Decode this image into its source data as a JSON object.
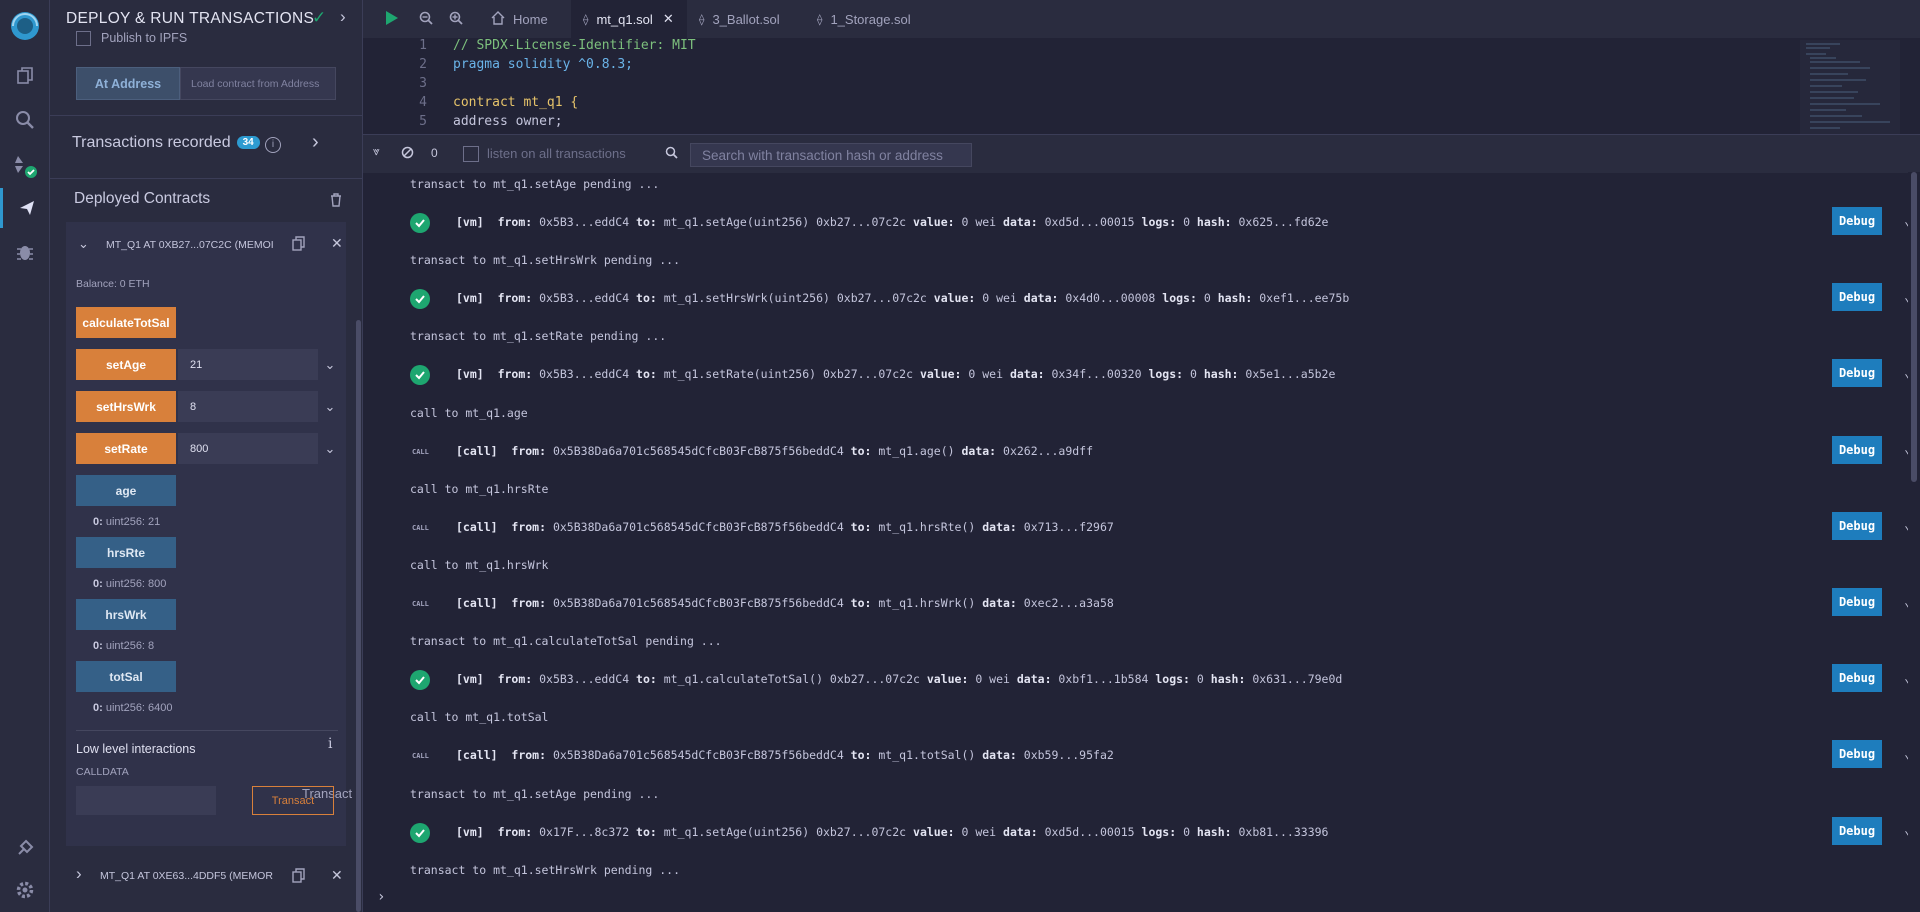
{
  "panel": {
    "title": "DEPLOY & RUN TRANSACTIONS",
    "publish_ipfs": "Publish to IPFS",
    "at_address_button": "At Address",
    "load_contract_placeholder": "Load contract from Address",
    "transactions_recorded": "Transactions recorded",
    "transactions_count": "34",
    "deployed_contracts": "Deployed Contracts",
    "instance_title": "MT_Q1 AT 0XB27...07C2C (MEMOI",
    "balance": "Balance: 0 ETH",
    "functions": {
      "calculate": "calculateTotSal",
      "setAge": {
        "label": "setAge",
        "value": "21"
      },
      "setHrsWrk": {
        "label": "setHrsWrk",
        "value": "8"
      },
      "setRate": {
        "label": "setRate",
        "value": "800"
      },
      "age": {
        "label": "age",
        "ret_key": "0:",
        "ret_val": "uint256: 21"
      },
      "hrsRte": {
        "label": "hrsRte",
        "ret_key": "0:",
        "ret_val": "uint256: 800"
      },
      "hrsWrk": {
        "label": "hrsWrk",
        "ret_key": "0:",
        "ret_val": "uint256: 8"
      },
      "totSal": {
        "label": "totSal",
        "ret_key": "0:",
        "ret_val": "uint256: 6400"
      }
    },
    "low_level": "Low level interactions",
    "calldata": "CALLDATA",
    "transact": "Transact",
    "instance2_title": "MT_Q1 AT 0XE63...4DDF5 (MEMOR"
  },
  "tabs": [
    "Home",
    "mt_q1.sol",
    "3_Ballot.sol",
    "1_Storage.sol"
  ],
  "editor": {
    "line_numbers": [
      "1",
      "2",
      "3",
      "4",
      "5"
    ],
    "lines": [
      "// SPDX-License-Identifier: MIT",
      "pragma solidity ^0.8.3;",
      "",
      "contract mt_q1 {",
      "address owner;"
    ]
  },
  "terminal": {
    "pending_count": "0",
    "listen_label": "listen on all transactions",
    "search_placeholder": "Search with transaction hash or address",
    "debug_label": "Debug",
    "entries": [
      {
        "pre": "transact to mt_q1.setAge pending ...",
        "kind": "vm",
        "line": "[vm]  from: 0x5B3...eddC4 to: mt_q1.setAge(uint256) 0xb27...07c2c value: 0 wei data: 0xd5d...00015 logs: 0 hash: 0x625...fd62e"
      },
      {
        "pre": "transact to mt_q1.setHrsWrk pending ...",
        "kind": "vm",
        "line": "[vm]  from: 0x5B3...eddC4 to: mt_q1.setHrsWrk(uint256) 0xb27...07c2c value: 0 wei data: 0x4d0...00008 logs: 0 hash: 0xef1...ee75b"
      },
      {
        "pre": "transact to mt_q1.setRate pending ...",
        "kind": "vm",
        "line": "[vm]  from: 0x5B3...eddC4 to: mt_q1.setRate(uint256) 0xb27...07c2c value: 0 wei data: 0x34f...00320 logs: 0 hash: 0x5e1...a5b2e"
      },
      {
        "pre": "call to mt_q1.age",
        "kind": "call",
        "line": "[call]  from: 0x5B38Da6a701c568545dCfcB03FcB875f56beddC4 to: mt_q1.age() data: 0x262...a9dff"
      },
      {
        "pre": "call to mt_q1.hrsRte",
        "kind": "call",
        "line": "[call]  from: 0x5B38Da6a701c568545dCfcB03FcB875f56beddC4 to: mt_q1.hrsRte() data: 0x713...f2967"
      },
      {
        "pre": "call to mt_q1.hrsWrk",
        "kind": "call",
        "line": "[call]  from: 0x5B38Da6a701c568545dCfcB03FcB875f56beddC4 to: mt_q1.hrsWrk() data: 0xec2...a3a58"
      },
      {
        "pre": "transact to mt_q1.calculateTotSal pending ...",
        "kind": "vm",
        "line": "[vm]  from: 0x5B3...eddC4 to: mt_q1.calculateTotSal() 0xb27...07c2c value: 0 wei data: 0xbf1...1b584 logs: 0 hash: 0x631...79e0d"
      },
      {
        "pre": "call to mt_q1.totSal",
        "kind": "call",
        "line": "[call]  from: 0x5B38Da6a701c568545dCfcB03FcB875f56beddC4 to: mt_q1.totSal() data: 0xb59...95fa2"
      },
      {
        "pre": "transact to mt_q1.setAge pending ...",
        "kind": "vm",
        "line": "[vm]  from: 0x17F...8c372 to: mt_q1.setAge(uint256) 0xb27...07c2c value: 0 wei data: 0xd5d...00015 logs: 0 hash: 0xb81...33396"
      }
    ],
    "tail_pre": "transact to mt_q1.setHrsWrk pending ...",
    "call_badge": "CALL"
  }
}
